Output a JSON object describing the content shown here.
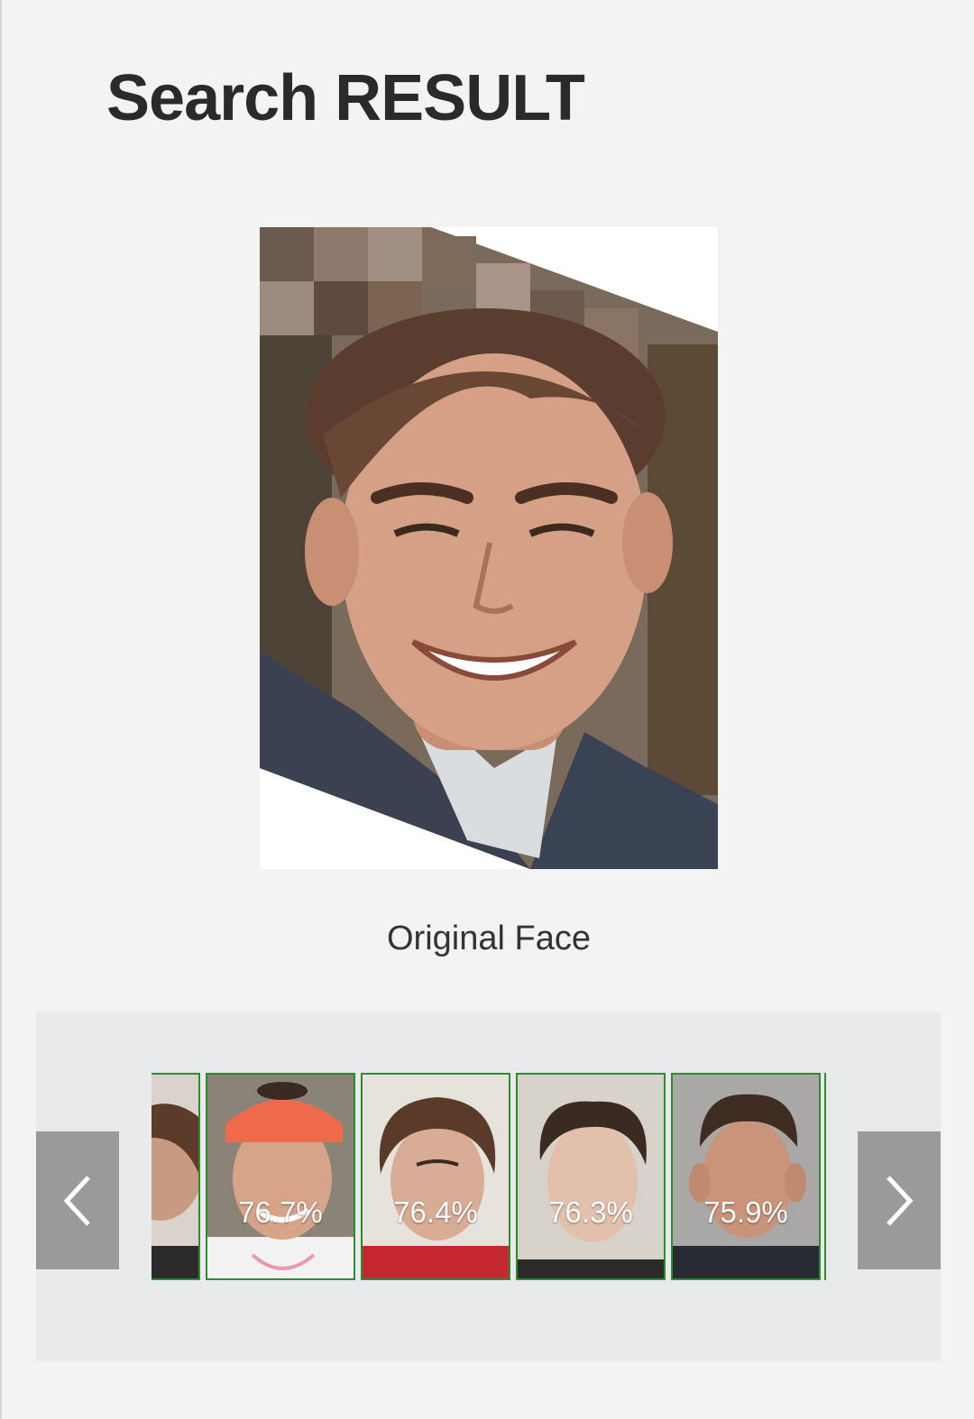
{
  "header": {
    "title": "Search RESULT"
  },
  "original": {
    "caption": "Original Face"
  },
  "carousel": {
    "prev_icon": "chevron-left-icon",
    "next_icon": "chevron-right-icon",
    "results": [
      {
        "score": "76.7%"
      },
      {
        "score": "76.4%"
      },
      {
        "score": "76.3%"
      },
      {
        "score": "75.9%"
      }
    ]
  },
  "colors": {
    "background": "#f3f3f3",
    "carousel_bg": "#e9eaeb",
    "thumb_border": "#2e8b2e",
    "nav_button": "#9a9a9a"
  }
}
